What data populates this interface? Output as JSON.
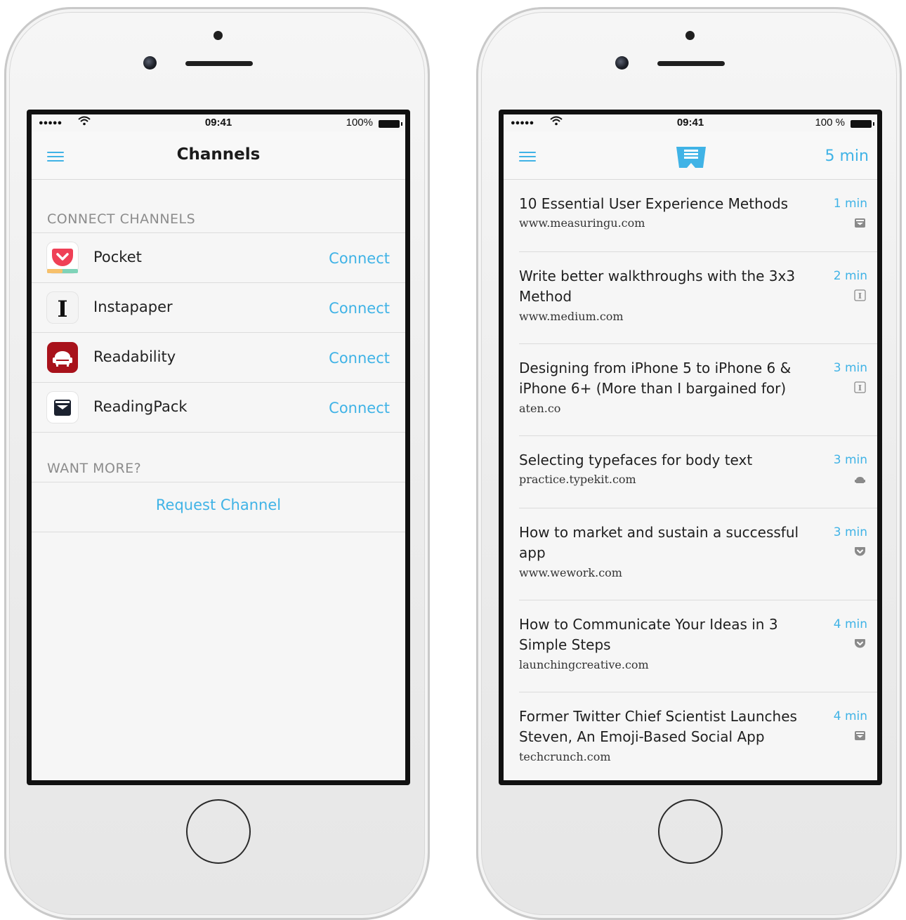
{
  "status": {
    "signal": "●●●●●",
    "time": "09:41",
    "battery_left": "100%",
    "battery_right": "100 %"
  },
  "left": {
    "title": "Channels",
    "section_connect": "CONNECT CHANNELS",
    "channels": [
      {
        "name": "Pocket",
        "action": "Connect",
        "icon": "pocket-icon"
      },
      {
        "name": "Instapaper",
        "action": "Connect",
        "icon": "instapaper-icon"
      },
      {
        "name": "Readability",
        "action": "Connect",
        "icon": "readability-icon"
      },
      {
        "name": "ReadingPack",
        "action": "Connect",
        "icon": "readingpack-icon"
      }
    ],
    "section_more": "WANT MORE?",
    "request": "Request Channel"
  },
  "right": {
    "total_time": "5 min",
    "articles": [
      {
        "title": "10 Essential User Experience Methods",
        "domain": "www.measuringu.com",
        "time": "1 min",
        "source": "readingpack-icon"
      },
      {
        "title": "Write better walkthroughs with the 3x3 Method",
        "domain": "www.medium.com",
        "time": "2 min",
        "source": "instapaper-icon"
      },
      {
        "title": "Designing from iPhone 5 to iPhone 6 & iPhone 6+ (More than I bargained for)",
        "domain": "aten.co",
        "time": "3 min",
        "source": "instapaper-icon"
      },
      {
        "title": "Selecting typefaces for body text",
        "domain": "practice.typekit.com",
        "time": "3 min",
        "source": "readability-icon"
      },
      {
        "title": "How to market and sustain a successful app",
        "domain": "www.wework.com",
        "time": "3 min",
        "source": "pocket-icon"
      },
      {
        "title": "How to Communicate Your Ideas in 3 Simple Steps",
        "domain": "launchingcreative.com",
        "time": "4 min",
        "source": "pocket-icon"
      },
      {
        "title": "Former Twitter Chief Scientist Launches Steven, An Emoji-Based Social App",
        "domain": "techcrunch.com",
        "time": "4 min",
        "source": "readingpack-icon"
      }
    ]
  },
  "colors": {
    "accent": "#40b3e6",
    "header": "#8c8c8c",
    "screen_bg": "#f6f6f6"
  }
}
